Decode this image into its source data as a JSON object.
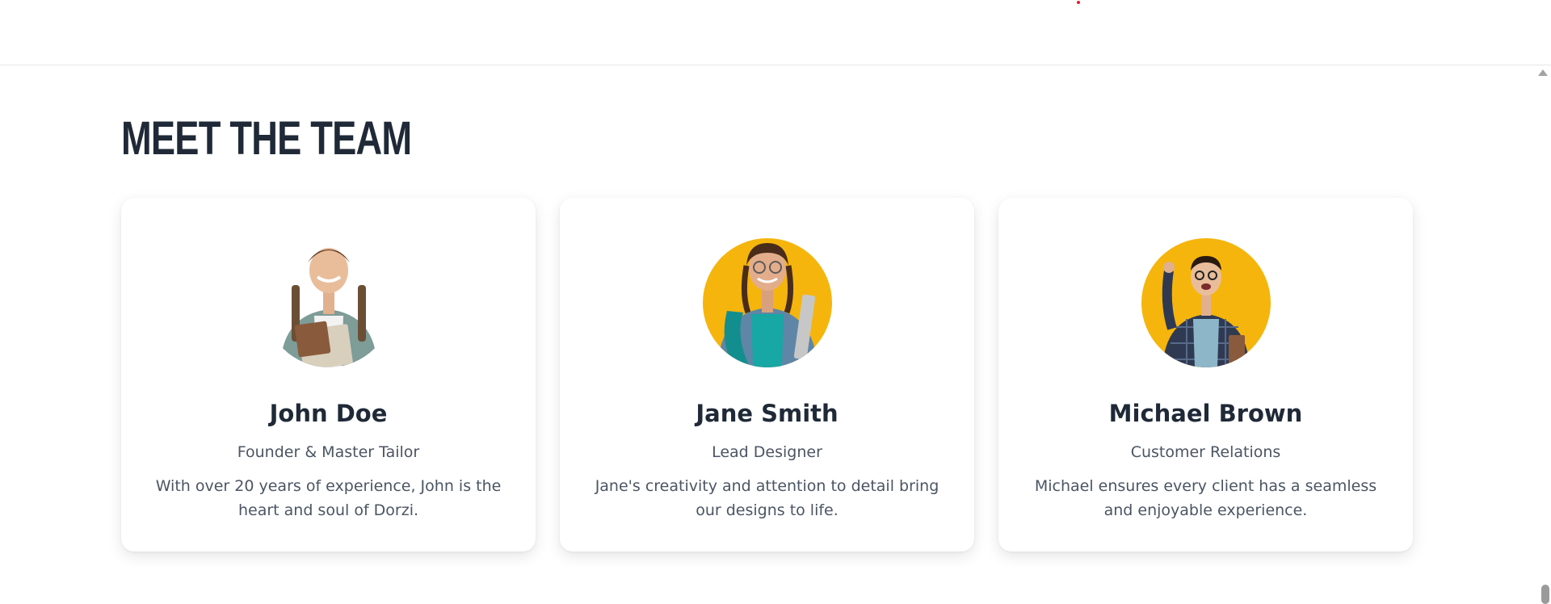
{
  "section": {
    "title": "MEET THE TEAM"
  },
  "team": [
    {
      "name": "John Doe",
      "role": "Founder & Master Tailor",
      "bio": "With over 20 years of experience, John is the heart and soul of Dorzi.",
      "photo_bg": "#ffffff",
      "shirt": "#7e9c98",
      "inner": "#f2f2f2"
    },
    {
      "name": "Jane Smith",
      "role": "Lead Designer",
      "bio": "Jane's creativity and attention to detail bring our designs to life.",
      "photo_bg": "#f5b50c",
      "shirt": "#5f86a6",
      "inner": "#17a7a5"
    },
    {
      "name": "Michael Brown",
      "role": "Customer Relations",
      "bio": "Michael ensures every client has a seamless and enjoyable experience.",
      "photo_bg": "#f5b50c",
      "shirt": "#2f3a52",
      "inner": "#8db6c8"
    }
  ],
  "colors": {
    "accent_dot": "#e11d2f",
    "text_dark": "#1f2937",
    "text_muted": "#4b5563"
  }
}
